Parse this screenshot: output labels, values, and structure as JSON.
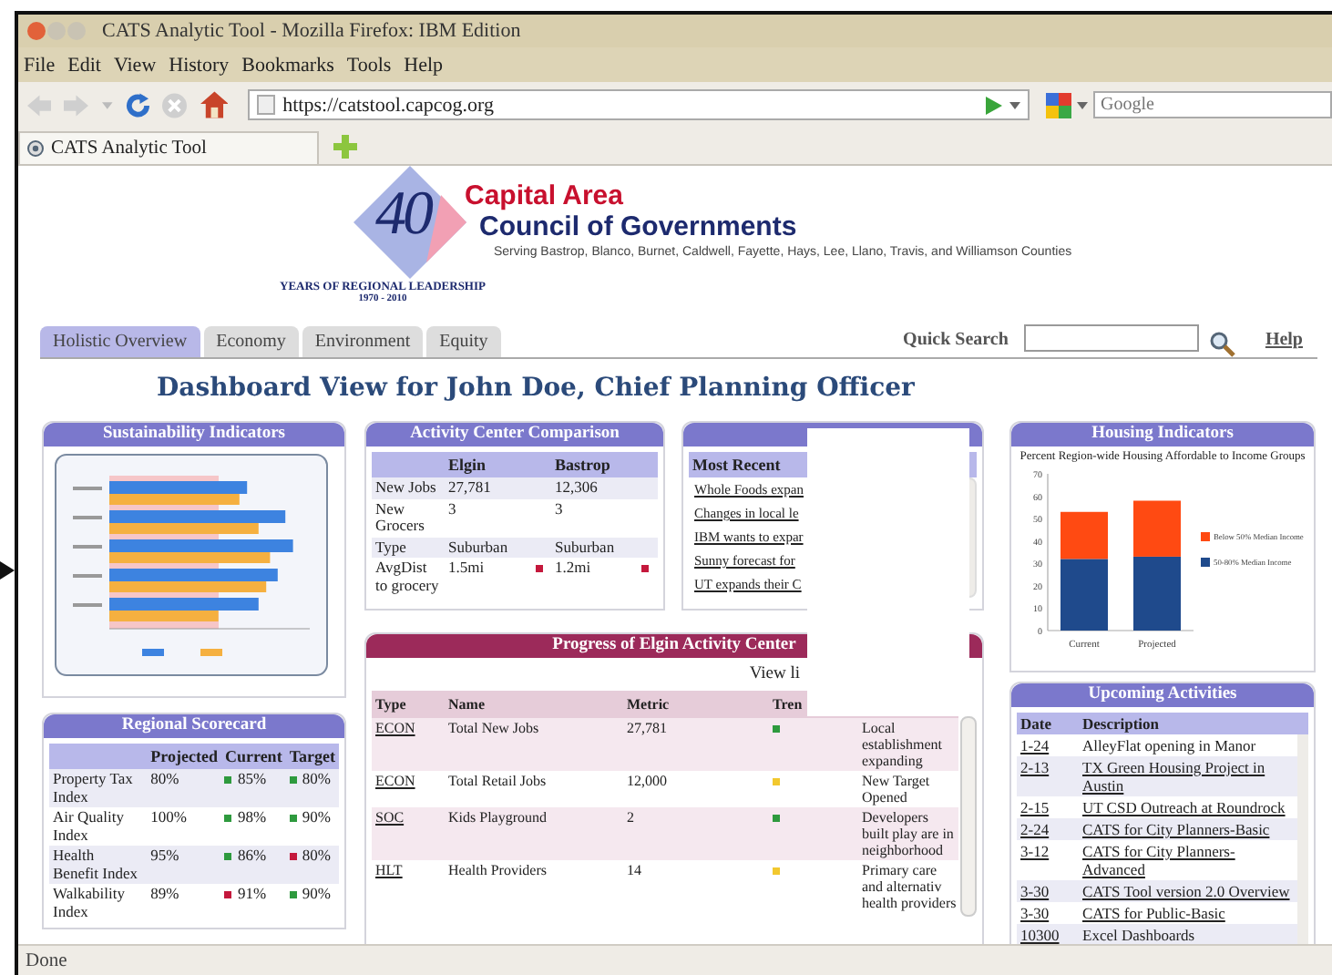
{
  "window": {
    "title": "CATS Analytic Tool - Mozilla Firefox: IBM Edition"
  },
  "menu": [
    "File",
    "Edit",
    "View",
    "History",
    "Bookmarks",
    "Tools",
    "Help"
  ],
  "toolbar": {
    "url": "https://catstool.capcog.org",
    "search_placeholder": "Google"
  },
  "browser_tabs": [
    {
      "label": "CATS Analytic Tool",
      "selected": true
    }
  ],
  "header": {
    "logo_number": "40",
    "title_1": "Capital Area",
    "title_2": "Council of Governments",
    "tagline": "Serving Bastrop, Blanco, Burnet, Caldwell, Fayette, Hays, Lee, Llano, Travis, and Williamson Counties",
    "years": "YEARS OF REGIONAL LEADERSHIP",
    "span": "1970 - 2010"
  },
  "nav_tabs": [
    {
      "label": "Holistic Overview",
      "selected": true
    },
    {
      "label": "Economy",
      "selected": false
    },
    {
      "label": "Environment",
      "selected": false
    },
    {
      "label": "Equity",
      "selected": false
    }
  ],
  "quick_search": {
    "label": "Quick Search"
  },
  "help": "Help",
  "heading": "Dashboard View for John Doe, Chief Planning Officer",
  "sustainability": {
    "title": "Sustainability Indicators"
  },
  "scorecard": {
    "title": "Regional Scorecard",
    "columns": [
      "Projected",
      "Current",
      "Target"
    ],
    "rows": [
      {
        "name": "Property Tax Index",
        "cells": [
          {
            "value": "80%"
          },
          {
            "value": "85%",
            "color": "#2e9a3e"
          },
          {
            "value": "80%",
            "color": "#2e9a3e"
          }
        ]
      },
      {
        "name": "Air Quality Index",
        "cells": [
          {
            "value": "100%"
          },
          {
            "value": "98%",
            "color": "#2e9a3e"
          },
          {
            "value": "90%",
            "color": "#2e9a3e"
          }
        ]
      },
      {
        "name": "Health Benefit Index",
        "cells": [
          {
            "value": "95%"
          },
          {
            "value": "86%",
            "color": "#2e9a3e"
          },
          {
            "value": "80%",
            "color": "#c4183c"
          }
        ]
      },
      {
        "name": "Walkability Index",
        "cells": [
          {
            "value": "89%"
          },
          {
            "value": "91%",
            "color": "#c4183c"
          },
          {
            "value": "90%",
            "color": "#2e9a3e"
          }
        ]
      }
    ]
  },
  "comparison": {
    "title": "Activity Center Comparison",
    "columns": [
      "Elgin",
      "Bastrop"
    ],
    "rows": [
      {
        "label": "New Jobs",
        "cells": [
          {
            "value": "27,781"
          },
          {
            "value": "12,306"
          }
        ]
      },
      {
        "label": "New Grocers",
        "cells": [
          {
            "value": "3"
          },
          {
            "value": "3"
          }
        ]
      },
      {
        "label": "Type",
        "cells": [
          {
            "value": "Suburban"
          },
          {
            "value": "Suburban"
          }
        ]
      },
      {
        "label": "AvgDist to grocery",
        "cells": [
          {
            "value": "1.5mi",
            "color": "#c4183c"
          },
          {
            "value": "1.2mi",
            "color": "#c4183c"
          }
        ]
      }
    ]
  },
  "alerts": {
    "column": "Most Recent",
    "items": [
      "Whole Foods expan",
      "Changes in local le",
      "IBM wants to expar",
      "Sunny forecast for",
      "UT expands their C"
    ]
  },
  "progress": {
    "title": "Progress of Elgin Activity Center",
    "view_link": "View li",
    "columns": [
      "Type",
      "Name",
      "Metric",
      "Tren"
    ],
    "rows": [
      {
        "type": "ECON",
        "name": "Total New Jobs",
        "metric": "27,781",
        "color": "#2e9a3e",
        "comment": "Local establishment expanding"
      },
      {
        "type": "ECON",
        "name": "Total Retail Jobs",
        "metric": "12,000",
        "color": "#f2c82e",
        "comment": "New Target Opened"
      },
      {
        "type": "SOC",
        "name": "Kids Playground",
        "metric": "2",
        "color": "#2e9a3e",
        "comment": "Developers built play are in neighborhood"
      },
      {
        "type": "HLT",
        "name": "Health Providers",
        "metric": "14",
        "color": "#f2c82e",
        "comment": "Primary care and alternativ health providers"
      }
    ]
  },
  "housing": {
    "title": "Housing Indicators",
    "chart_data": {
      "type": "bar",
      "title": "Percent Region-wide Housing Affordable to Income Groups",
      "categories": [
        "Current",
        "Projected"
      ],
      "series": [
        {
          "name": "50-80% Median Income",
          "color": "#1f4a8c",
          "values": [
            32,
            33
          ]
        },
        {
          "name": "Below 50% Median Income",
          "color": "#ff4a12",
          "values": [
            21,
            25
          ]
        }
      ],
      "ylim": [
        0,
        70
      ],
      "yticks": [
        0,
        10,
        20,
        30,
        40,
        50,
        60,
        70
      ],
      "stacked": true,
      "legend": "right"
    }
  },
  "upcoming": {
    "title": "Upcoming Activities",
    "columns": [
      "Date",
      "Description"
    ],
    "rows": [
      {
        "date": "1-24",
        "description": "AlleyFlat opening in Manor",
        "link": false
      },
      {
        "date": "2-13",
        "description": "TX Green Housing Project in Austin",
        "link": true
      },
      {
        "date": "2-15",
        "description": "UT CSD Outreach at Roundrock",
        "link": true
      },
      {
        "date": "2-24",
        "description": "CATS for City Planners-Basic",
        "link": true
      },
      {
        "date": "3-12",
        "description": "CATS for City Planners-Advanced",
        "link": true
      },
      {
        "date": "3-30",
        "description": "CATS Tool version 2.0 Overview",
        "link": true
      },
      {
        "date": "3-30",
        "description": "CATS for Public-Basic",
        "link": true
      },
      {
        "date": "10300",
        "description": "Excel Dashboards",
        "link": false
      }
    ]
  },
  "status_bar": "Done"
}
